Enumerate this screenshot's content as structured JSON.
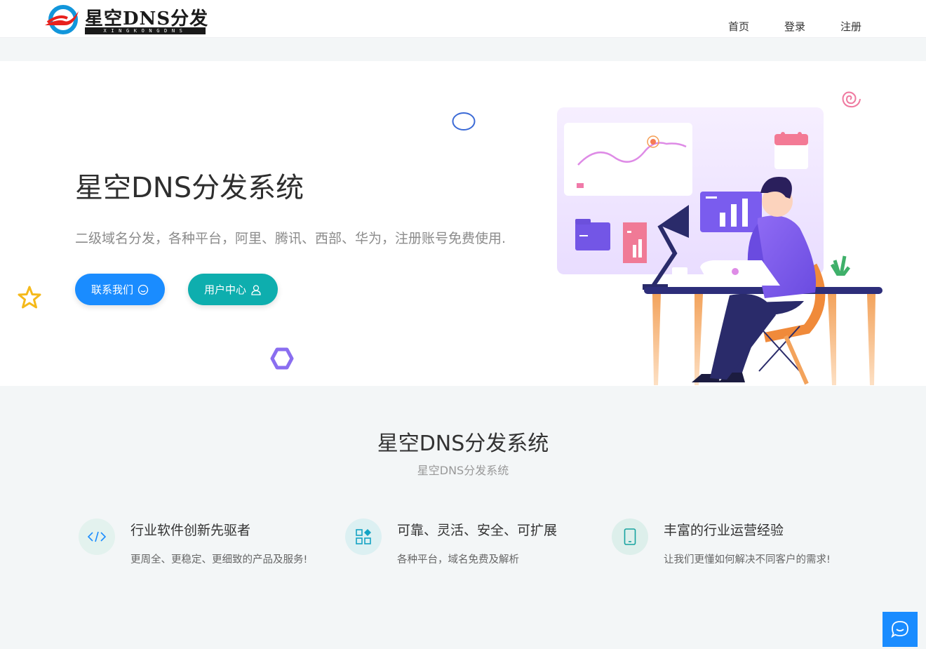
{
  "header": {
    "logo_text": "星空DNS分发",
    "logo_sub": "XINGKONGDNS",
    "nav": [
      "首页",
      "登录",
      "注册"
    ]
  },
  "hero": {
    "title": "星空DNS分发系统",
    "subtitle": "二级域名分发，各种平台，阿里、腾讯、西部、华为，注册账号免费使用.",
    "btn_contact": "联系我们",
    "btn_user": "用户中心"
  },
  "features_section": {
    "title": "星空DNS分发系统",
    "subtitle": "星空DNS分发系统",
    "items": [
      {
        "title": "行业软件创新先驱者",
        "desc": "更周全、更稳定、更细致的产品及服务!",
        "icon": "code-icon",
        "color": "#1ab3a0"
      },
      {
        "title": "可靠、灵活、安全、可扩展",
        "desc": "各种平台，域名免费及解析",
        "icon": "blocks-icon",
        "color": "#14a3c4"
      },
      {
        "title": "丰富的行业运营经验",
        "desc": "让我们更懂如何解决不同客户的需求!",
        "icon": "tablet-icon",
        "color": "#16a3a0"
      }
    ]
  },
  "colors": {
    "primary": "#1a8cff",
    "teal": "#0eaeae",
    "bg": "#f3f6f7"
  }
}
